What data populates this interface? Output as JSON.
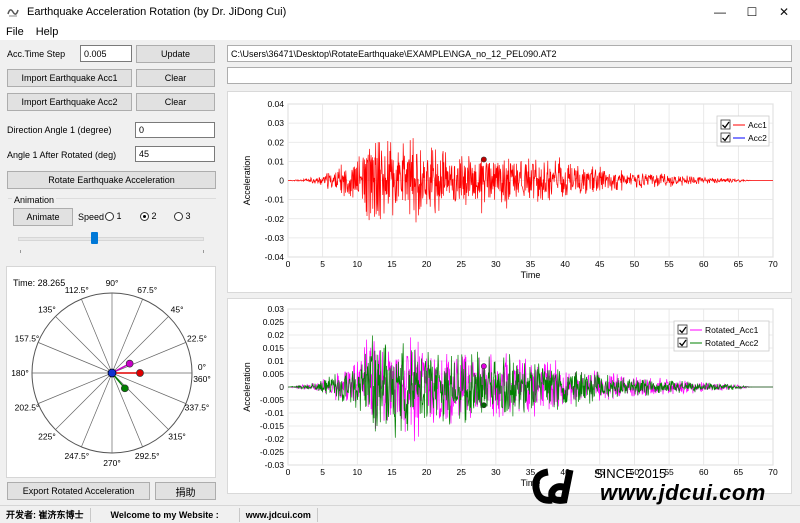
{
  "window": {
    "title": "Earthquake Acceleration Rotation (by Dr. JiDong Cui)",
    "minimize": "—",
    "maximize": "☐",
    "close": "✕"
  },
  "menu": [
    "File",
    "Help"
  ],
  "left": {
    "acc_time_step_label": "Acc.Time Step",
    "acc_time_step_value": "0.005",
    "update_label": "Update",
    "import_acc1_label": "Import Earthquake Acc1",
    "clear1_label": "Clear",
    "import_acc2_label": "Import Earthquake Acc2",
    "clear2_label": "Clear",
    "direction_angle_label": "Direction Angle 1 (degree)",
    "direction_angle_value": "0",
    "after_rotated_label": "Angle 1 After Rotated (deg)",
    "after_rotated_value": "45",
    "rotate_label": "Rotate Earthquake Acceleration",
    "animation_group_label": "Animation",
    "animate_label": "Animate",
    "speed_label": "Speed",
    "speed_options": [
      "1",
      "2",
      "3"
    ],
    "speed_selected": "2",
    "slider_level": 0.4,
    "export_label": "Export Rotated Acceleration",
    "donate_label": "捐助"
  },
  "polar": {
    "time_label": "Time: 28.265",
    "angle_labels": [
      "0°",
      "22.5°",
      "45°",
      "67.5°",
      "90°",
      "112.5°",
      "135°",
      "157.5°",
      "180°",
      "202.5°",
      "225°",
      "247.5°",
      "270°",
      "292.5°",
      "315°",
      "337.5°",
      "360°"
    ],
    "vectors": [
      {
        "angle_deg": 0,
        "magnitude": 0.28,
        "color": "#e00000"
      },
      {
        "angle_deg": 28,
        "magnitude": 0.2,
        "color": "#c800c8"
      },
      {
        "angle_deg": -50,
        "magnitude": 0.2,
        "color": "#008000"
      }
    ]
  },
  "file_path": "C:\\Users\\36471\\Desktop\\RotateEarthquake\\EXAMPLE\\NGA_no_12_PEL090.AT2",
  "second_path": "",
  "status": {
    "developer": "开发者: 崔济东博士",
    "welcome": "Welcome to my Website :",
    "website": "www.jdcui.com"
  },
  "watermark": {
    "since": "SINCE 2015",
    "url": "www.jdcui.com"
  },
  "chart_data": [
    {
      "type": "line",
      "title": "",
      "xlabel": "Time",
      "ylabel": "Acceleration",
      "xlim": [
        0,
        70
      ],
      "ylim": [
        -0.04,
        0.04
      ],
      "xticks": [
        0,
        5,
        10,
        15,
        20,
        25,
        30,
        35,
        40,
        45,
        50,
        55,
        60,
        65,
        70
      ],
      "yticks": [
        0.04,
        0.03,
        0.02,
        0.01,
        0,
        -0.01,
        -0.02,
        -0.03,
        -0.04
      ],
      "grid": true,
      "legend_position": "top-right",
      "marker": {
        "x": 28.265,
        "y": 0.011
      },
      "series": [
        {
          "name": "Acc1",
          "color": "#ff0000",
          "visible": true,
          "envelope": [
            [
              0,
              0
            ],
            [
              4,
              0.002
            ],
            [
              7,
              0.007
            ],
            [
              10,
              0.014
            ],
            [
              12,
              0.025
            ],
            [
              13,
              0.035
            ],
            [
              14,
              0.028
            ],
            [
              15,
              0.03
            ],
            [
              16,
              0.02
            ],
            [
              17,
              0.024
            ],
            [
              18,
              0.03
            ],
            [
              19,
              0.02
            ],
            [
              20,
              0.022
            ],
            [
              22,
              0.018
            ],
            [
              24,
              0.017
            ],
            [
              26,
              0.017
            ],
            [
              28,
              0.02
            ],
            [
              30,
              0.015
            ],
            [
              32,
              0.016
            ],
            [
              35,
              0.013
            ],
            [
              38,
              0.015
            ],
            [
              40,
              0.012
            ],
            [
              42,
              0.009
            ],
            [
              45,
              0.008
            ],
            [
              50,
              0.005
            ],
            [
              55,
              0.004
            ],
            [
              60,
              0.002
            ],
            [
              65,
              0.001
            ],
            [
              67,
              0
            ]
          ]
        },
        {
          "name": "Acc2",
          "color": "#0000ff",
          "visible": true,
          "envelope": []
        }
      ]
    },
    {
      "type": "line",
      "title": "",
      "xlabel": "Time",
      "ylabel": "Acceleration",
      "xlim": [
        0,
        70
      ],
      "ylim": [
        -0.03,
        0.03
      ],
      "xticks": [
        0,
        5,
        10,
        15,
        20,
        25,
        30,
        35,
        40,
        45,
        50,
        55,
        60,
        65,
        70
      ],
      "yticks": [
        0.03,
        0.025,
        0.02,
        0.015,
        0.01,
        0.005,
        0,
        -0.005,
        -0.01,
        -0.015,
        -0.02,
        -0.025,
        -0.03
      ],
      "grid": true,
      "legend_position": "top-right",
      "markers": [
        {
          "x": 28.265,
          "y": 0.008
        },
        {
          "x": 28.265,
          "y": -0.007
        }
      ],
      "series": [
        {
          "name": "Rotated_Acc1",
          "color": "#ff00ff",
          "visible": true,
          "envelope": [
            [
              0,
              0
            ],
            [
              4,
              0.002
            ],
            [
              7,
              0.006
            ],
            [
              10,
              0.012
            ],
            [
              12,
              0.022
            ],
            [
              13,
              0.028
            ],
            [
              14,
              0.02
            ],
            [
              16,
              0.022
            ],
            [
              18,
              0.024
            ],
            [
              20,
              0.02
            ],
            [
              22,
              0.017
            ],
            [
              24,
              0.017
            ],
            [
              26,
              0.016
            ],
            [
              28,
              0.016
            ],
            [
              30,
              0.015
            ],
            [
              32,
              0.014
            ],
            [
              35,
              0.012
            ],
            [
              38,
              0.011
            ],
            [
              40,
              0.01
            ],
            [
              42,
              0.008
            ],
            [
              45,
              0.007
            ],
            [
              50,
              0.005
            ],
            [
              55,
              0.004
            ],
            [
              60,
              0.002
            ],
            [
              65,
              0.001
            ],
            [
              67,
              0
            ]
          ]
        },
        {
          "name": "Rotated_Acc2",
          "color": "#008000",
          "visible": true,
          "envelope": [
            [
              0,
              0
            ],
            [
              4,
              0.002
            ],
            [
              7,
              0.006
            ],
            [
              10,
              0.011
            ],
            [
              12,
              0.02
            ],
            [
              13,
              0.029
            ],
            [
              14,
              0.02
            ],
            [
              16,
              0.021
            ],
            [
              18,
              0.02
            ],
            [
              20,
              0.019
            ],
            [
              22,
              0.017
            ],
            [
              24,
              0.015
            ],
            [
              26,
              0.015
            ],
            [
              28,
              0.015
            ],
            [
              30,
              0.013
            ],
            [
              32,
              0.014
            ],
            [
              35,
              0.013
            ],
            [
              38,
              0.01
            ],
            [
              40,
              0.009
            ],
            [
              42,
              0.008
            ],
            [
              45,
              0.006
            ],
            [
              50,
              0.004
            ],
            [
              55,
              0.003
            ],
            [
              60,
              0.002
            ],
            [
              65,
              0.001
            ],
            [
              67,
              0
            ]
          ]
        }
      ]
    }
  ]
}
